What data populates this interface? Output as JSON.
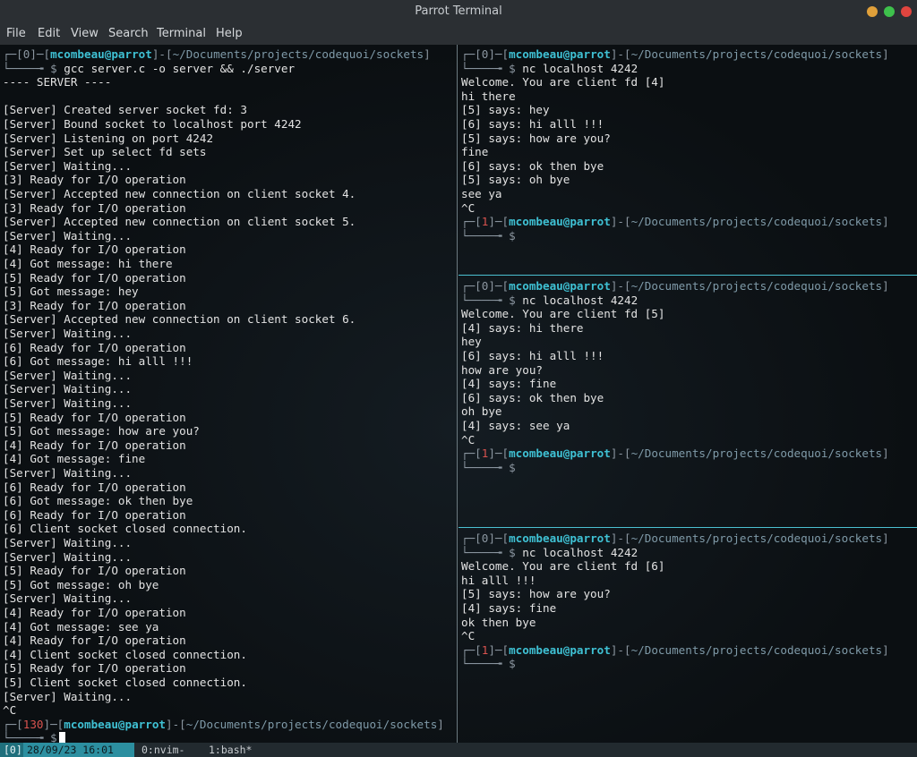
{
  "window": {
    "title": "Parrot Terminal"
  },
  "menu": [
    "File",
    "Edit",
    "View",
    "Search",
    "Terminal",
    "Help"
  ],
  "left_pane": {
    "prompt": {
      "code": "0",
      "user_host": "mcombeau@parrot",
      "path": "~/Documents/projects/codequoi/sockets",
      "command": "gcc server.c -o server && ./server"
    },
    "output": [
      "---- SERVER ----",
      "",
      "[Server] Created server socket fd: 3",
      "[Server] Bound socket to localhost port 4242",
      "[Server] Listening on port 4242",
      "[Server] Set up select fd sets",
      "[Server] Waiting...",
      "[3] Ready for I/O operation",
      "[Server] Accepted new connection on client socket 4.",
      "[3] Ready for I/O operation",
      "[Server] Accepted new connection on client socket 5.",
      "[Server] Waiting...",
      "[4] Ready for I/O operation",
      "[4] Got message: hi there",
      "[5] Ready for I/O operation",
      "[5] Got message: hey",
      "[3] Ready for I/O operation",
      "[Server] Accepted new connection on client socket 6.",
      "[Server] Waiting...",
      "[6] Ready for I/O operation",
      "[6] Got message: hi alll !!!",
      "[Server] Waiting...",
      "[Server] Waiting...",
      "[Server] Waiting...",
      "[5] Ready for I/O operation",
      "[5] Got message: how are you?",
      "[4] Ready for I/O operation",
      "[4] Got message: fine",
      "[Server] Waiting...",
      "[6] Ready for I/O operation",
      "[6] Got message: ok then bye",
      "[6] Ready for I/O operation",
      "[6] Client socket closed connection.",
      "[Server] Waiting...",
      "[Server] Waiting...",
      "[5] Ready for I/O operation",
      "[5] Got message: oh bye",
      "[Server] Waiting...",
      "[4] Ready for I/O operation",
      "[4] Got message: see ya",
      "[4] Ready for I/O operation",
      "[4] Client socket closed connection.",
      "[5] Ready for I/O operation",
      "[5] Client socket closed connection.",
      "[Server] Waiting...",
      "^C"
    ],
    "final_prompt": {
      "code": "130",
      "user_host": "mcombeau@parrot",
      "path": "~/Documents/projects/codequoi/sockets"
    }
  },
  "right_panes": [
    {
      "prompt": {
        "code": "0",
        "user_host": "mcombeau@parrot",
        "path": "~/Documents/projects/codequoi/sockets",
        "command": "nc localhost 4242"
      },
      "output": [
        "Welcome. You are client fd [4]",
        "hi there",
        "[5] says: hey",
        "[6] says: hi alll !!!",
        "[5] says: how are you?",
        "fine",
        "[6] says: ok then bye",
        "[5] says: oh bye",
        "see ya",
        "^C"
      ],
      "final_prompt": {
        "code": "1",
        "user_host": "mcombeau@parrot",
        "path": "~/Documents/projects/codequoi/sockets"
      }
    },
    {
      "prompt": {
        "code": "0",
        "user_host": "mcombeau@parrot",
        "path": "~/Documents/projects/codequoi/sockets",
        "command": "nc localhost 4242"
      },
      "output": [
        "Welcome. You are client fd [5]",
        "[4] says: hi there",
        "hey",
        "[6] says: hi alll !!!",
        "how are you?",
        "[4] says: fine",
        "[6] says: ok then bye",
        "oh bye",
        "[4] says: see ya",
        "^C"
      ],
      "final_prompt": {
        "code": "1",
        "user_host": "mcombeau@parrot",
        "path": "~/Documents/projects/codequoi/sockets"
      }
    },
    {
      "prompt": {
        "code": "0",
        "user_host": "mcombeau@parrot",
        "path": "~/Documents/projects/codequoi/sockets",
        "command": "nc localhost 4242"
      },
      "output": [
        "Welcome. You are client fd [6]",
        "hi alll !!!",
        "[5] says: how are you?",
        "[4] says: fine",
        "ok then bye",
        "^C"
      ],
      "final_prompt": {
        "code": "1",
        "user_host": "mcombeau@parrot",
        "path": "~/Documents/projects/codequoi/sockets"
      }
    }
  ],
  "status_bar": {
    "session": "[0]",
    "datetime": "28/09/23 16:01",
    "windows": [
      "0:nvim-",
      "1:bash*"
    ]
  },
  "colors": {
    "accent": "#3fc1d4",
    "error_code": "#d9534f",
    "background": "#0b0f12"
  }
}
